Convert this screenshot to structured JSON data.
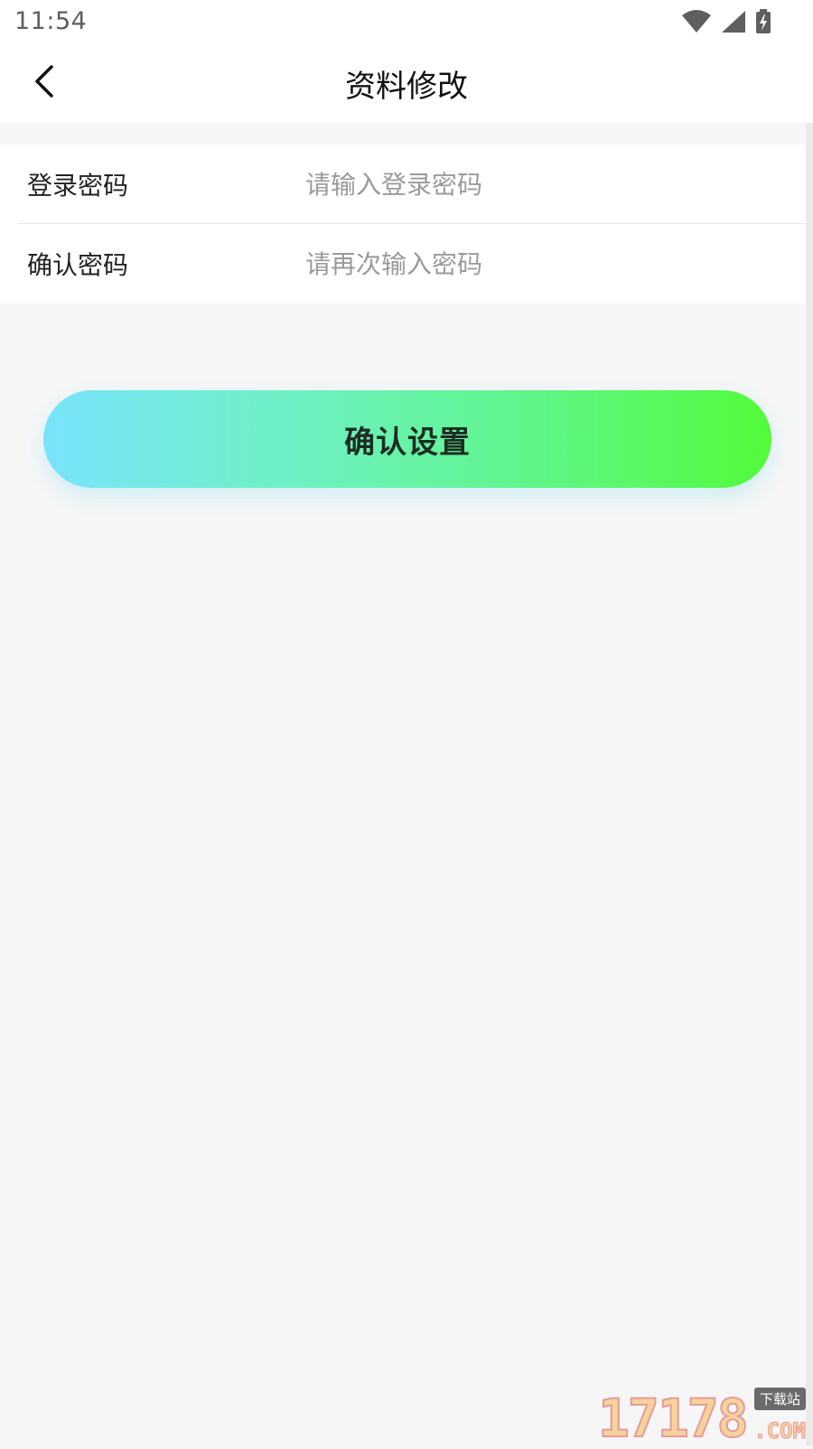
{
  "status_bar": {
    "time": "11:54",
    "icons": [
      "wifi-icon",
      "signal-icon",
      "battery-charging-icon"
    ]
  },
  "header": {
    "back_icon": "chevron-left-icon",
    "title": "资料修改"
  },
  "form": {
    "fields": [
      {
        "label": "登录密码",
        "value": "",
        "placeholder": "请输入登录密码"
      },
      {
        "label": "确认密码",
        "value": "",
        "placeholder": "请再次输入密码"
      }
    ]
  },
  "confirm_button": {
    "label": "确认设置",
    "gradient_start": "#78e4fb",
    "gradient_end": "#52fb3a"
  },
  "watermark": {
    "digits": "17178",
    "tag": "下载站",
    "suffix": ".COM"
  }
}
